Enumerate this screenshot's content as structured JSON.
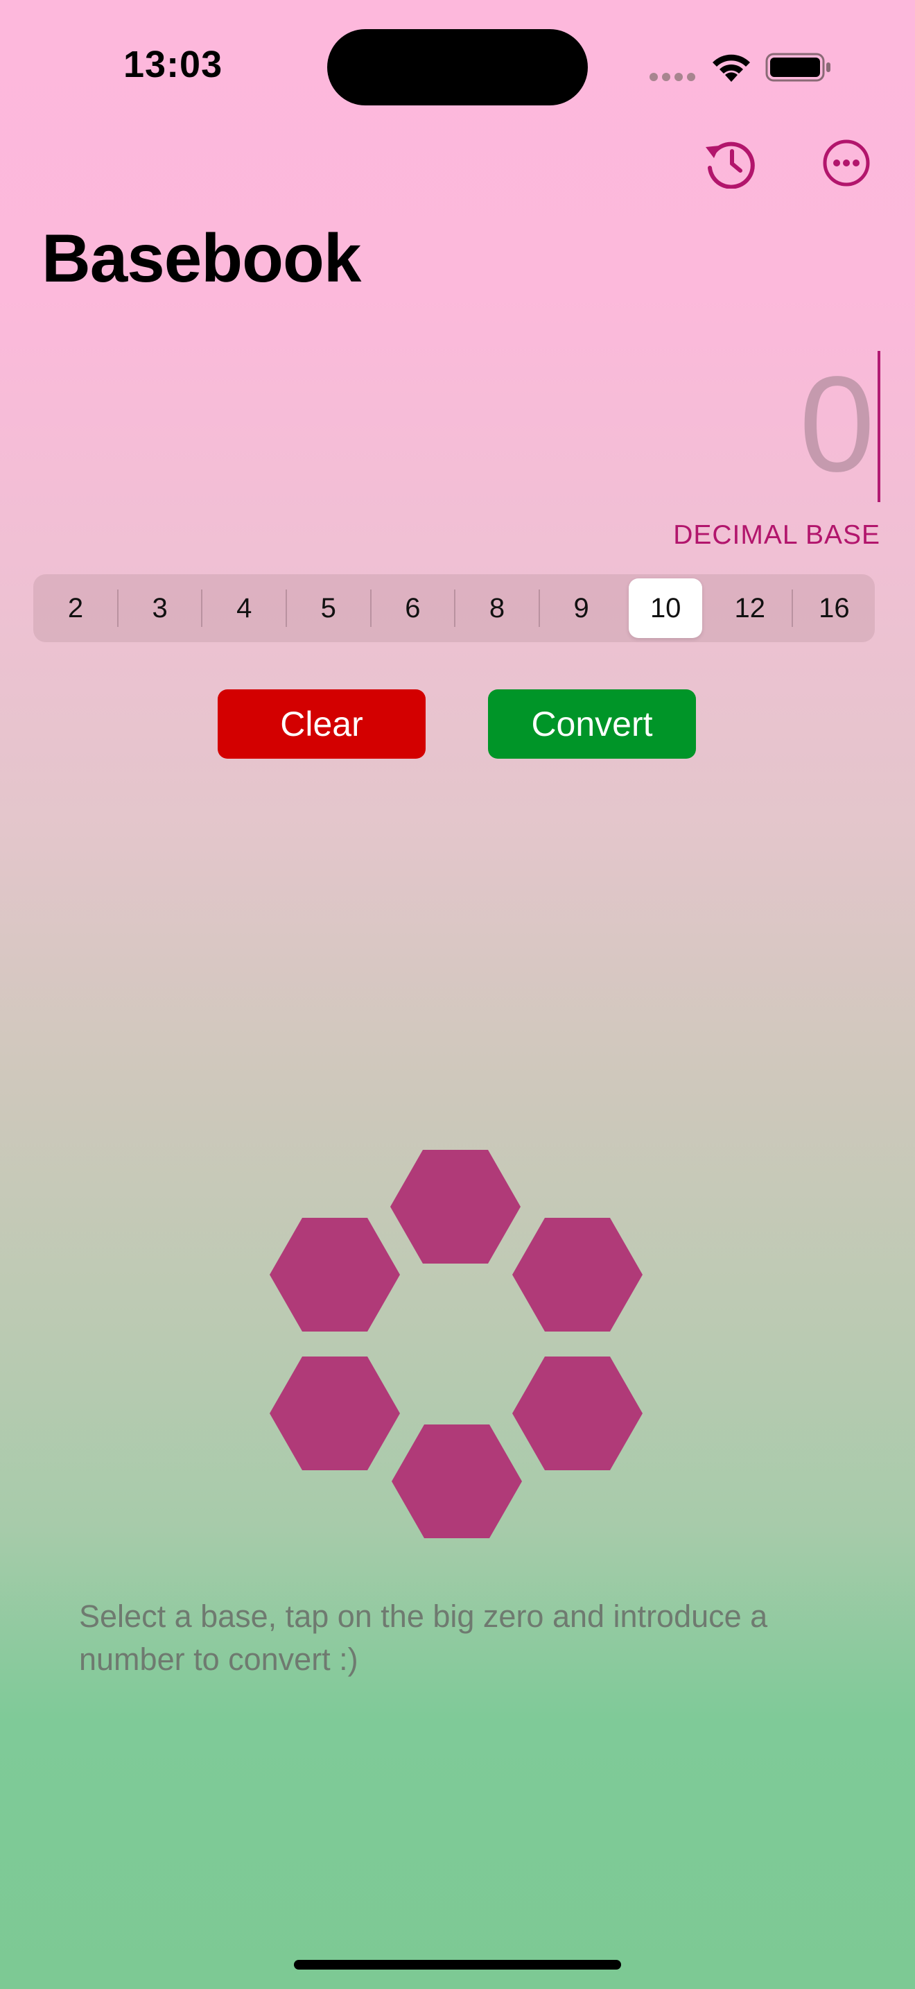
{
  "status_bar": {
    "time": "13:03"
  },
  "toolbar": {
    "history_icon": "history-icon",
    "more_icon": "ellipsis-circle-icon"
  },
  "title": "Basebook",
  "input": {
    "value": "0",
    "base_label": "DECIMAL BASE"
  },
  "bases": {
    "options": [
      "2",
      "3",
      "4",
      "5",
      "6",
      "8",
      "9",
      "10",
      "12",
      "16"
    ],
    "selected": "10"
  },
  "buttons": {
    "clear": "Clear",
    "convert": "Convert"
  },
  "hint": "Select a base, tap on the big zero and introduce a number to convert :)",
  "colors": {
    "accent": "#b2156c",
    "clear": "#d30000",
    "convert": "#009528",
    "hexagon": "#b03a78"
  }
}
